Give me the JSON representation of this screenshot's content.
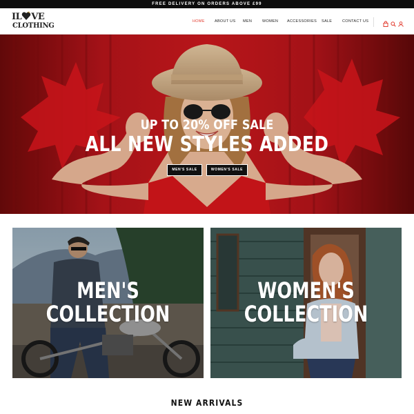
{
  "announcement": "FREE DELIVERY ON ORDERS ABOVE £99",
  "logo": {
    "line1_left": "IL",
    "line1_right": "VE",
    "line2": "CLOTHING"
  },
  "nav": {
    "items": [
      {
        "label": "HOME",
        "active": true
      },
      {
        "label": "ABOUT US",
        "active": false
      },
      {
        "label": "MEN",
        "active": false
      },
      {
        "label": "WOMEN",
        "active": false
      },
      {
        "label": "ACCESSORIES",
        "active": false
      },
      {
        "label": "SALE",
        "active": false
      },
      {
        "label": "CONTACT US",
        "active": false
      }
    ],
    "icons": [
      "bag-icon",
      "search-icon",
      "user-icon"
    ]
  },
  "hero": {
    "line1": "UP TO 20% OFF SALE",
    "line2": "ALL NEW STYLES ADDED",
    "buttons": [
      "MEN'S SALE",
      "WOMEN'S SALE"
    ]
  },
  "collections": [
    {
      "line1": "MEN'S",
      "line2": "COLLECTION"
    },
    {
      "line1": "WOMEN'S",
      "line2": "COLLECTION"
    }
  ],
  "new_arrivals_title": "NEW ARRIVALS",
  "colors": {
    "accent": "#e23b2e",
    "topbar": "#0d0d0d",
    "hero_red": "#c4161c",
    "button_bg": "#111111"
  }
}
